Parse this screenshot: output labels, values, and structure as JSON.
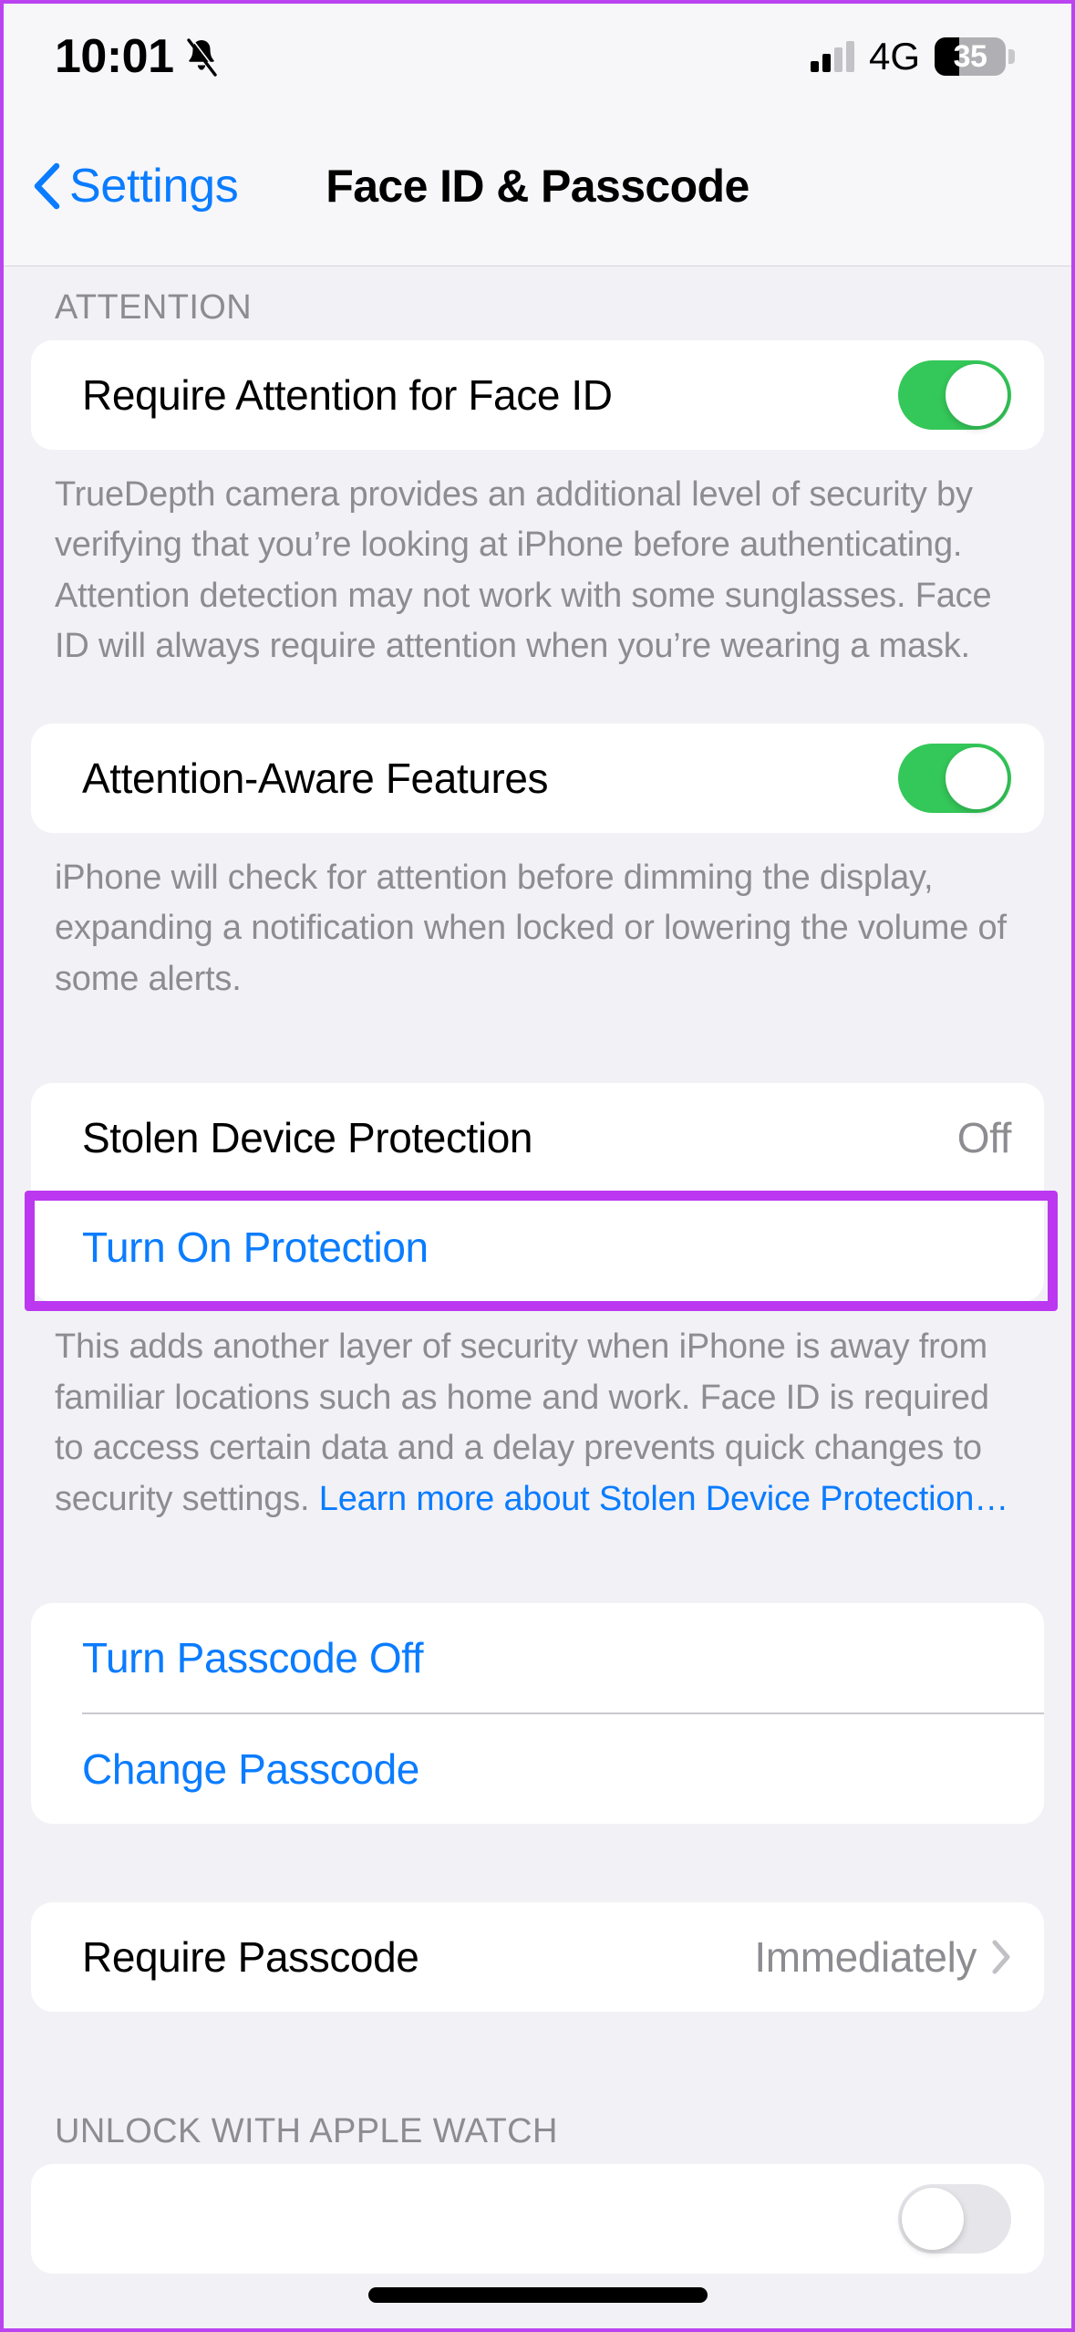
{
  "status_bar": {
    "time": "10:01",
    "silent_icon": "bell-slash-icon",
    "network": "4G",
    "battery_percent": "35",
    "battery_level": 35,
    "signal_bars_active": 2,
    "signal_bars_total": 4
  },
  "nav": {
    "back_label": "Settings",
    "title": "Face ID & Passcode"
  },
  "sections": {
    "attention_header": "ATTENTION",
    "require_attention": {
      "label": "Require Attention for Face ID",
      "toggle_state": "on",
      "footer": "TrueDepth camera provides an additional level of security by verifying that you’re looking at iPhone before authenticating. Attention detection may not work with some sunglasses. Face ID will always require attention when you’re wearing a mask."
    },
    "attention_aware": {
      "label": "Attention-Aware Features",
      "toggle_state": "on",
      "footer": "iPhone will check for attention before dimming the display, expanding a notification when locked or lowering the volume of some alerts."
    },
    "stolen_device": {
      "label": "Stolen Device Protection",
      "value": "Off",
      "action_label": "Turn On Protection",
      "footer_text": "This adds another layer of security when iPhone is away from familiar locations such as home and work. Face ID is required to access certain data and a delay prevents quick changes to security settings. ",
      "footer_link": "Learn more about Stolen Device Protection…"
    },
    "passcode": {
      "turn_off_label": "Turn Passcode Off",
      "change_label": "Change Passcode"
    },
    "require_passcode": {
      "label": "Require Passcode",
      "value": "Immediately"
    },
    "apple_watch_header": "UNLOCK WITH APPLE WATCH"
  },
  "colors": {
    "accent_blue": "#0a7cff",
    "toggle_green": "#34c759",
    "highlight_purple": "#bb38f0",
    "group_bg": "#f2f1f6",
    "card_bg": "#ffffff",
    "secondary_text": "#8c8c91"
  }
}
